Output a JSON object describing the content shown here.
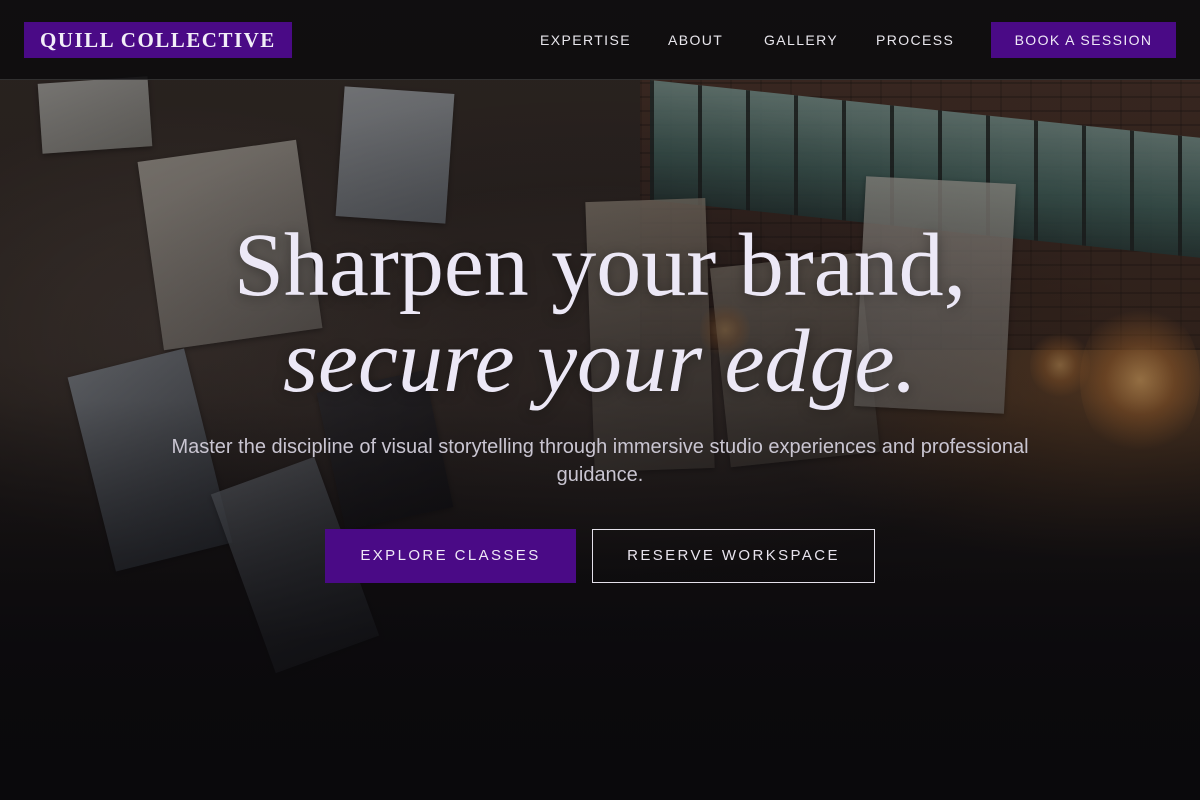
{
  "brand": {
    "name": "QUILL COLLECTIVE",
    "accent_color": "#4a0a86"
  },
  "nav": {
    "items": [
      {
        "label": "EXPERTISE"
      },
      {
        "label": "ABOUT"
      },
      {
        "label": "GALLERY"
      },
      {
        "label": "PROCESS"
      }
    ],
    "cta_label": "BOOK A SESSION"
  },
  "hero": {
    "title_line1": "Sharpen your brand,",
    "title_line2": "secure your edge.",
    "subtitle": "Master the discipline of visual storytelling through immersive studio experiences and professional guidance.",
    "primary_button": "EXPLORE CLASSES",
    "secondary_button": "RESERVE WORKSPACE",
    "background_image": "art studio with canvases, brick wall, windows and chandelier"
  }
}
